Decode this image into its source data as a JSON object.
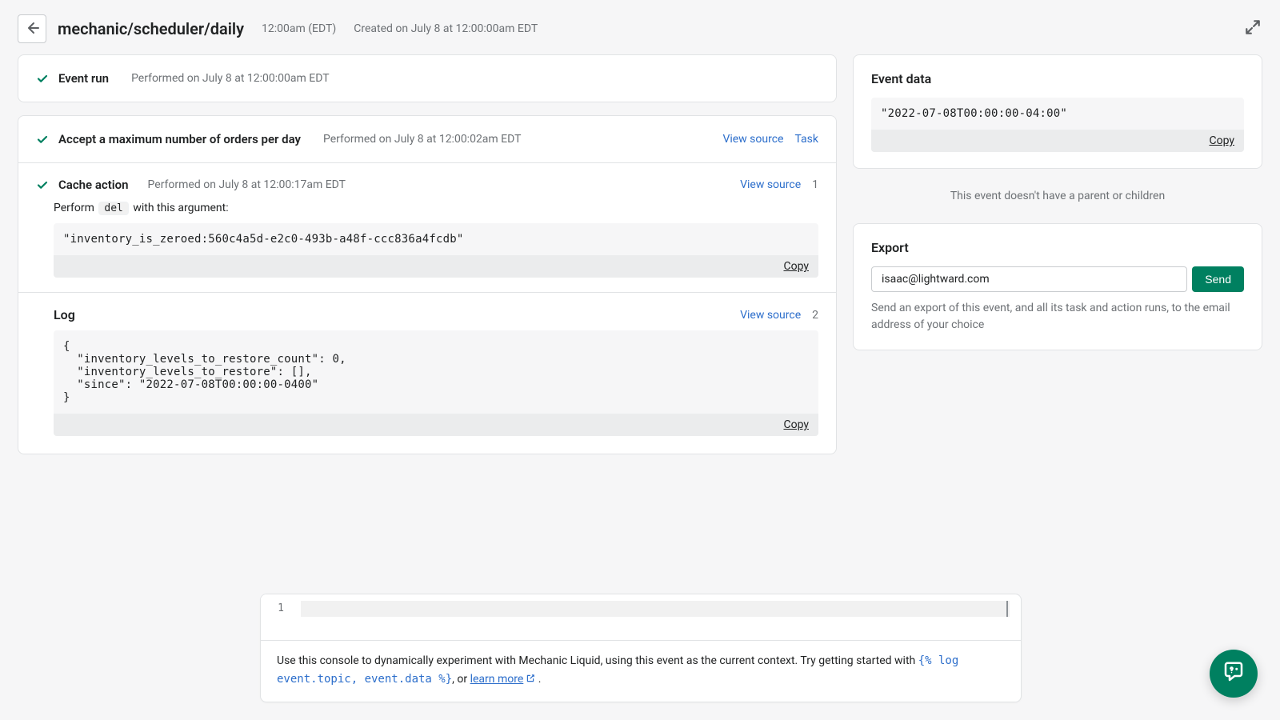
{
  "header": {
    "title": "mechanic/scheduler/daily",
    "time": "12:00am (EDT)",
    "created": "Created on July 8 at 12:00:00am EDT"
  },
  "event_run": {
    "title": "Event run",
    "performed": "Performed on July 8 at 12:00:00am EDT"
  },
  "task": {
    "title": "Accept a maximum number of orders per day",
    "performed": "Performed on July 8 at 12:00:02am EDT",
    "view_source_label": "View source",
    "task_link_label": "Task"
  },
  "cache": {
    "title": "Cache action",
    "performed": "Performed on July 8 at 12:00:17am EDT",
    "view_source_label": "View source",
    "index": "1",
    "perform_prefix": "Perform",
    "perform_cmd": "del",
    "perform_suffix": "with this argument:",
    "argument": "\"inventory_is_zeroed:560c4a5d-e2c0-493b-a48f-ccc836a4fcdb\"",
    "copy_label": "Copy"
  },
  "log": {
    "title": "Log",
    "view_source_label": "View source",
    "index": "2",
    "content": "{\n  \"inventory_levels_to_restore_count\": 0,\n  \"inventory_levels_to_restore\": [],\n  \"since\": \"2022-07-08T00:00:00-0400\"\n}",
    "copy_label": "Copy"
  },
  "sidebar": {
    "event_data": {
      "title": "Event data",
      "content": "\"2022-07-08T00:00:00-04:00\"",
      "copy_label": "Copy"
    },
    "parent_text": "This event doesn't have a parent or children",
    "export": {
      "title": "Export",
      "email": "isaac@lightward.com",
      "send_label": "Send",
      "help": "Send an export of this event, and all its task and action runs, to the email address of your choice"
    }
  },
  "console": {
    "line_no": "1",
    "help_prefix": "Use this console to dynamically experiment with Mechanic Liquid, using this event as the current context. Try getting started with ",
    "code_sample": "{% log event.topic, event.data %}",
    "or_text": ", or ",
    "learn_more": "learn more",
    "period": " ."
  }
}
